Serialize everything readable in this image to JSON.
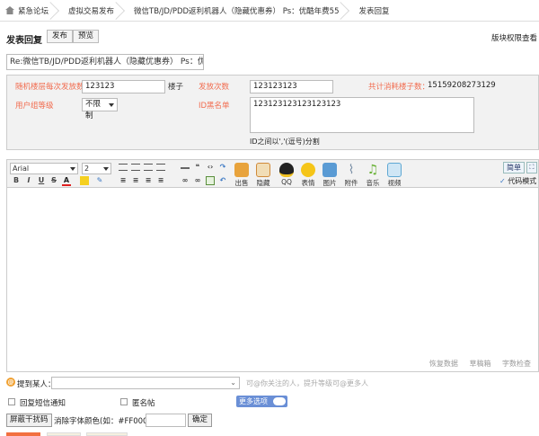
{
  "breadcrumb": [
    "紧急论坛",
    "虚拟交易发布",
    "微信TB/JD/PDD返利机器人（隐藏优惠券） Ps：优酷年费55",
    "发表回复"
  ],
  "header": {
    "title": "发表回复",
    "publish_label": "发布",
    "preview_label": "预览",
    "permission_label": "版块权限查看"
  },
  "subject": "Re:微信TB/JD/PDD返利机器人（隐藏优惠券） Ps：优f",
  "options": {
    "per_floor_label": "随机楼层每次发放数",
    "per_floor_value": "123123",
    "unit_label": "楼子",
    "times_label": "发放次数",
    "times_value": "123123123",
    "total_label": "共计消耗楼子数：",
    "total_value": "15159208273129",
    "usergroup_label": "用户组等级",
    "usergroup_value": "不限制",
    "blacklist_label": "ID黑名单",
    "blacklist_value": "123123123123123123",
    "hint": "ID之间以','(逗号)分割"
  },
  "toolbar": {
    "font_family": "Arial",
    "font_size": "2",
    "tools": [
      {
        "label": "出售",
        "icon": "sell-icon",
        "color": "#e8a33c"
      },
      {
        "label": "隐藏",
        "icon": "hide-icon",
        "color": "#d08a3a"
      },
      {
        "label": "QQ",
        "icon": "qq-icon",
        "color": "#222222"
      },
      {
        "label": "表情",
        "icon": "smiley-icon",
        "color": "#f5c518"
      },
      {
        "label": "图片",
        "icon": "image-icon",
        "color": "#5a9bd4"
      },
      {
        "label": "附件",
        "icon": "attachment-icon",
        "color": "#7a8fa6"
      },
      {
        "label": "音乐",
        "icon": "music-icon",
        "color": "#66b032"
      },
      {
        "label": "视频",
        "icon": "video-icon",
        "color": "#5fa8d3"
      }
    ],
    "mode_label": "简单",
    "code_mode_label": "代码模式"
  },
  "editor": {
    "content": "",
    "status": [
      "恢复数据",
      "草稿箱",
      "字数检查"
    ]
  },
  "footer": {
    "mention_label": "提到某人：",
    "mention_placeholder": "可@你关注的人，提升等级可@更多人",
    "reply_notify_label": "回复短信通知",
    "anonymous_label": "匿名帖",
    "more_options_label": "更多选项",
    "shield_button": "屏蔽干扰码",
    "color_label": "消除字体颜色(如：#FF0000)：",
    "color_value": "",
    "confirm_button": "确定"
  },
  "colors": {
    "accent_red": "#f26c4f",
    "toggle_blue": "#6a8fd6",
    "bottom_orange": "#f27040"
  }
}
